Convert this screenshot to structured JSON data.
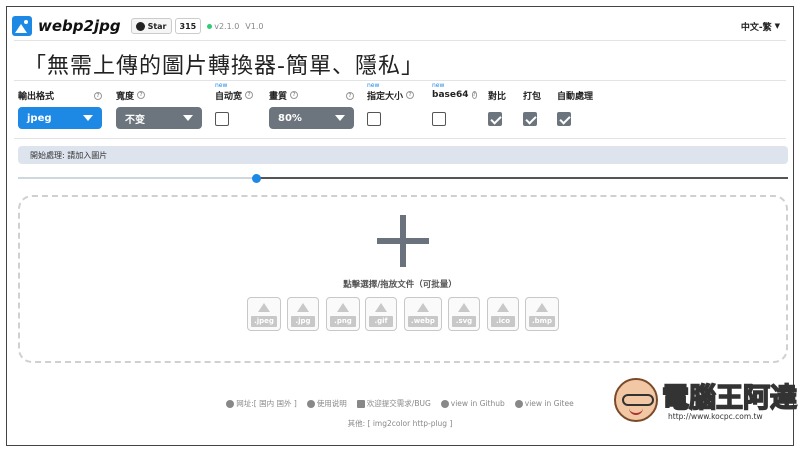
{
  "header": {
    "brand": "webp2jpg",
    "star_label": "Star",
    "star_count": "315",
    "version": "v2.1.0",
    "version2": "V1.0",
    "language": "中文-繁"
  },
  "headline": "「無需上傳的圖片轉換器-簡單、隱私」",
  "options": {
    "format": {
      "label": "輸出格式",
      "value": "jpeg"
    },
    "width": {
      "label": "寬度",
      "value": "不变"
    },
    "auto": {
      "badge": "new",
      "label": "自动宽"
    },
    "quality": {
      "label": "畫質",
      "value": "80%"
    },
    "size": {
      "badge": "new",
      "label": "指定大小"
    },
    "base64": {
      "badge": "new",
      "label": "base64"
    },
    "compare": {
      "label": "對比",
      "checked": true
    },
    "pack": {
      "label": "打包",
      "checked": true
    },
    "auto_process": {
      "label": "自動處理",
      "checked": true
    }
  },
  "status": "開始處理: 請加入圖片",
  "slider": {
    "value_fraction": 0.31
  },
  "dropzone": {
    "text": "點擊選擇/拖放文件（可批量）",
    "types": [
      ".jpeg",
      ".jpg",
      ".png",
      ".gif",
      ".webp",
      ".svg",
      ".ico",
      ".bmp"
    ]
  },
  "footer": {
    "site": "网址:[ 国内 国外 ]",
    "help": "使用说明",
    "feedback": "欢迎提交需求/BUG",
    "github": "view in Github",
    "gitee": "view in Gitee",
    "other": "其他: [ img2color  http-plug ]"
  },
  "watermark": {
    "title": "電腦王阿達",
    "url": "http://www.kocpc.com.tw"
  },
  "colors": {
    "accent": "#1e88e5",
    "gray_control": "#6c757d",
    "status_bg": "#dde4ee"
  }
}
